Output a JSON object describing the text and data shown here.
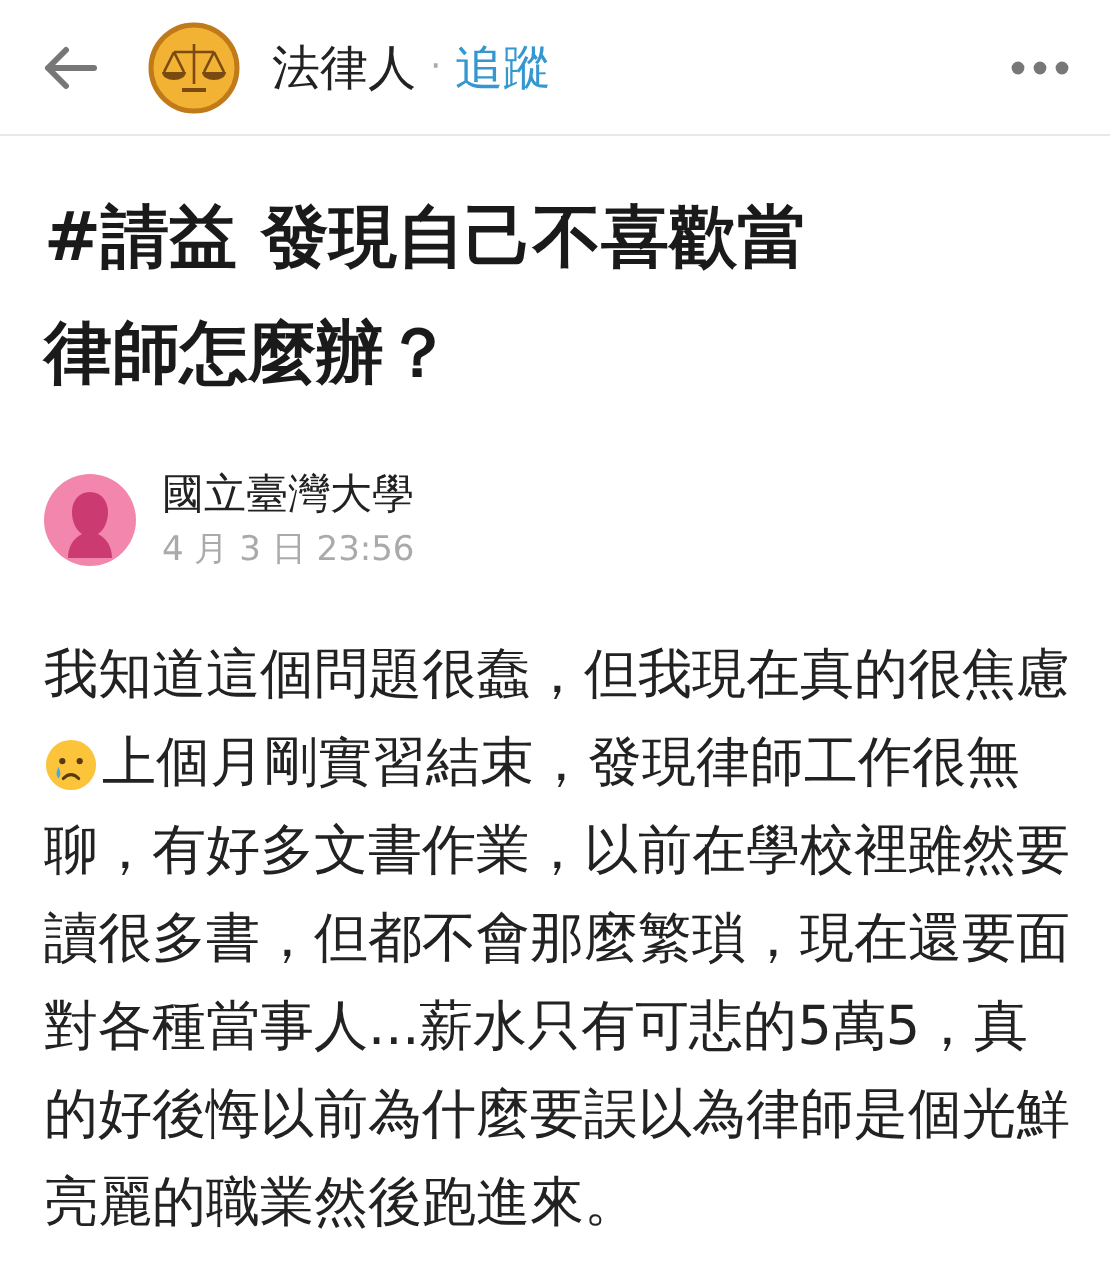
{
  "header": {
    "board": "法律人",
    "separator": "·",
    "follow": "追蹤"
  },
  "post": {
    "title": "#請益 發現自己不喜歡當律師怎麼辦？",
    "author": "國立臺灣大學",
    "date": "4 月 3 日 23:56",
    "body": [
      {
        "kind": "text",
        "text": "我知道這個問題很蠢，但我現在真的很焦慮"
      },
      {
        "kind": "emoji"
      },
      {
        "kind": "text",
        "text": "上個月剛實習結束，發現律師工作很無"
      },
      {
        "kind": "text",
        "text": "聊，有好多文書作業，以前在學校裡雖然要讀很多書，但都不會那麼繁瑣，現在還要面對各種當事人...薪水只有可悲的5萬5，真的好後悔以前為什麼要誤以為律師是個光鮮亮麗的職業然後跑進來。"
      }
    ]
  }
}
